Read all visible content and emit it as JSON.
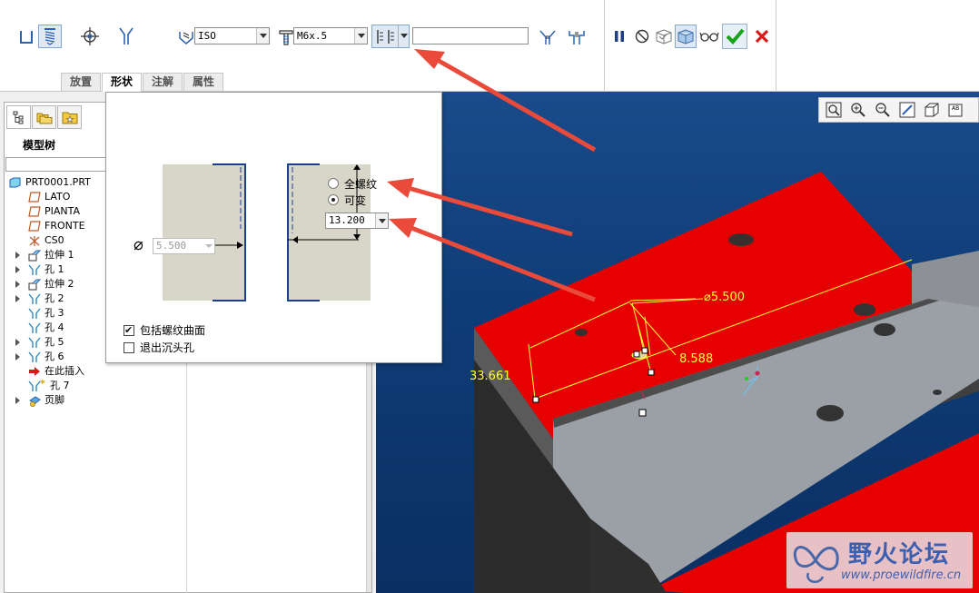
{
  "dashboard": {
    "standard_value": "ISO",
    "screw_size_value": "M6x.5",
    "depth_value_input": "",
    "tabs": [
      {
        "label": "放置",
        "active": false
      },
      {
        "label": "形状",
        "active": true
      },
      {
        "label": "注解",
        "active": false
      },
      {
        "label": "属性",
        "active": false
      }
    ]
  },
  "left_panel": {
    "title": "模型树",
    "tree": [
      {
        "label": "PRT0001.PRT",
        "icon": "part-icon",
        "expandable": false,
        "indent": 0
      },
      {
        "label": "LATO",
        "icon": "datum-plane-icon",
        "expandable": false,
        "indent": 1
      },
      {
        "label": "PIANTA",
        "icon": "datum-plane-icon",
        "expandable": false,
        "indent": 1
      },
      {
        "label": "FRONTE",
        "icon": "datum-plane-icon",
        "expandable": false,
        "indent": 1
      },
      {
        "label": "CS0",
        "icon": "coordinate-system-icon",
        "expandable": false,
        "indent": 1
      },
      {
        "label": "拉伸 1",
        "icon": "extrude-icon",
        "expandable": true,
        "indent": 1
      },
      {
        "label": "孔 1",
        "icon": "hole-icon",
        "expandable": true,
        "indent": 1
      },
      {
        "label": "拉伸 2",
        "icon": "extrude-icon",
        "expandable": true,
        "indent": 1
      },
      {
        "label": "孔 2",
        "icon": "hole-icon",
        "expandable": true,
        "indent": 1
      },
      {
        "label": "孔 3",
        "icon": "hole-icon",
        "expandable": false,
        "indent": 1
      },
      {
        "label": "孔 4",
        "icon": "hole-icon",
        "expandable": false,
        "indent": 1
      },
      {
        "label": "孔 5",
        "icon": "hole-icon",
        "expandable": true,
        "indent": 1
      },
      {
        "label": "孔 6",
        "icon": "hole-icon",
        "expandable": true,
        "indent": 1
      },
      {
        "label": "在此插入",
        "icon": "insert-here-icon",
        "expandable": false,
        "indent": 1
      },
      {
        "label": "孔 7",
        "icon": "hole-new-icon",
        "expandable": false,
        "indent": 1
      },
      {
        "label": "页脚",
        "icon": "footer-icon",
        "expandable": true,
        "indent": 1
      }
    ]
  },
  "shape_panel": {
    "diameter_value": "5.500",
    "radio_full": "全螺纹",
    "radio_variable": "可变",
    "selected_radio": "variable",
    "thread_depth_value": "13.200",
    "check_thread_surface": "包括螺纹曲面",
    "check_thread_surface_checked": true,
    "check_exit_countersink": "退出沉头孔",
    "check_exit_countersink_checked": false
  },
  "viewport": {
    "dim_diameter": "⌀5.500",
    "dim_a": "33.661",
    "dim_b": "8.588"
  },
  "watermark": {
    "title": "野火论坛",
    "url": "www.proewildfire.cn"
  },
  "colors": {
    "annotation_arrow": "#ea4a3a",
    "red_surface": "#e60000",
    "dim_yellow": "#ffff33",
    "accept_green": "#1aa21a",
    "cancel_red": "#d71919"
  }
}
